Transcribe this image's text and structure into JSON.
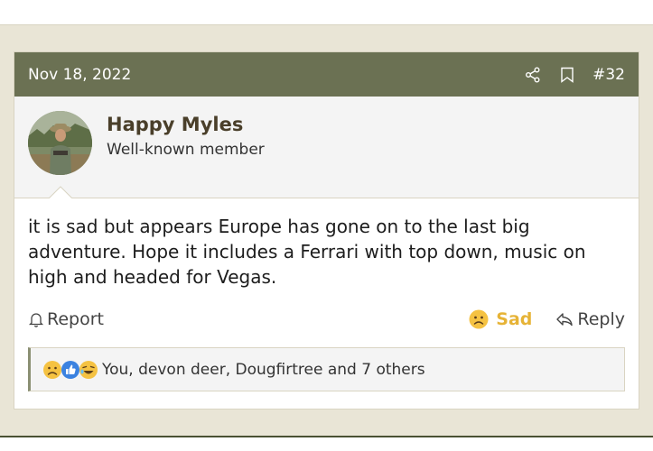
{
  "post": {
    "date": "Nov 18, 2022",
    "number": "#32",
    "share_icon": "share-icon",
    "bookmark_icon": "bookmark-icon",
    "author": {
      "name": "Happy Myles",
      "title": "Well-known member"
    },
    "message": "it is sad but appears Europe has gone on to the last big adventure. Hope it includes a Ferrari with top down, music on high and headed for Vegas.",
    "actions": {
      "report_label": "Report",
      "reaction_label": "Sad",
      "reply_label": "Reply"
    },
    "reactions_summary": "You, devon deer, Dougfirtree and 7 others"
  },
  "colors": {
    "header_bg": "#6b7153",
    "sad_accent": "#e6b336",
    "page_bg": "#e9e5d6"
  }
}
